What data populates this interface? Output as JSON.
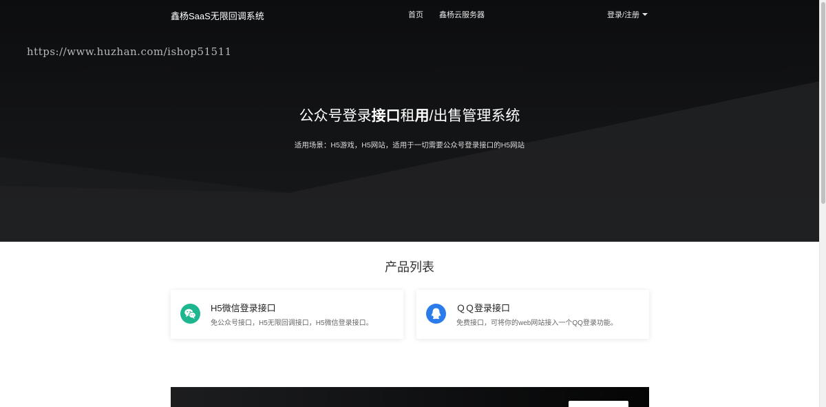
{
  "nav": {
    "brand": "鑫杨SaaS无限回调系统",
    "links": [
      "首页",
      "鑫杨云服务器"
    ],
    "login": "登录/注册"
  },
  "watermark": "https://www.huzhan.com/ishop51511",
  "hero": {
    "title_parts": [
      "公众号登录",
      "接口",
      "租",
      "用",
      "/出售管理系统"
    ],
    "subtitle": "适用场景：H5游戏，H5网站，适用于一切需要公众号登录接口的H5网站"
  },
  "products": {
    "section_title": "产品列表",
    "items": [
      {
        "title": "H5微信登录接口",
        "desc": "免公众号接口，H5无限回调接口，H5微信登录接口。",
        "icon": "wechat-icon",
        "color": "#1eb68e"
      },
      {
        "title": "ＱＱ登录接口",
        "desc": "免费接口，可将你的web网站接入一个QQ登录功能。",
        "icon": "qq-icon",
        "color": "#2b7bea"
      }
    ]
  }
}
